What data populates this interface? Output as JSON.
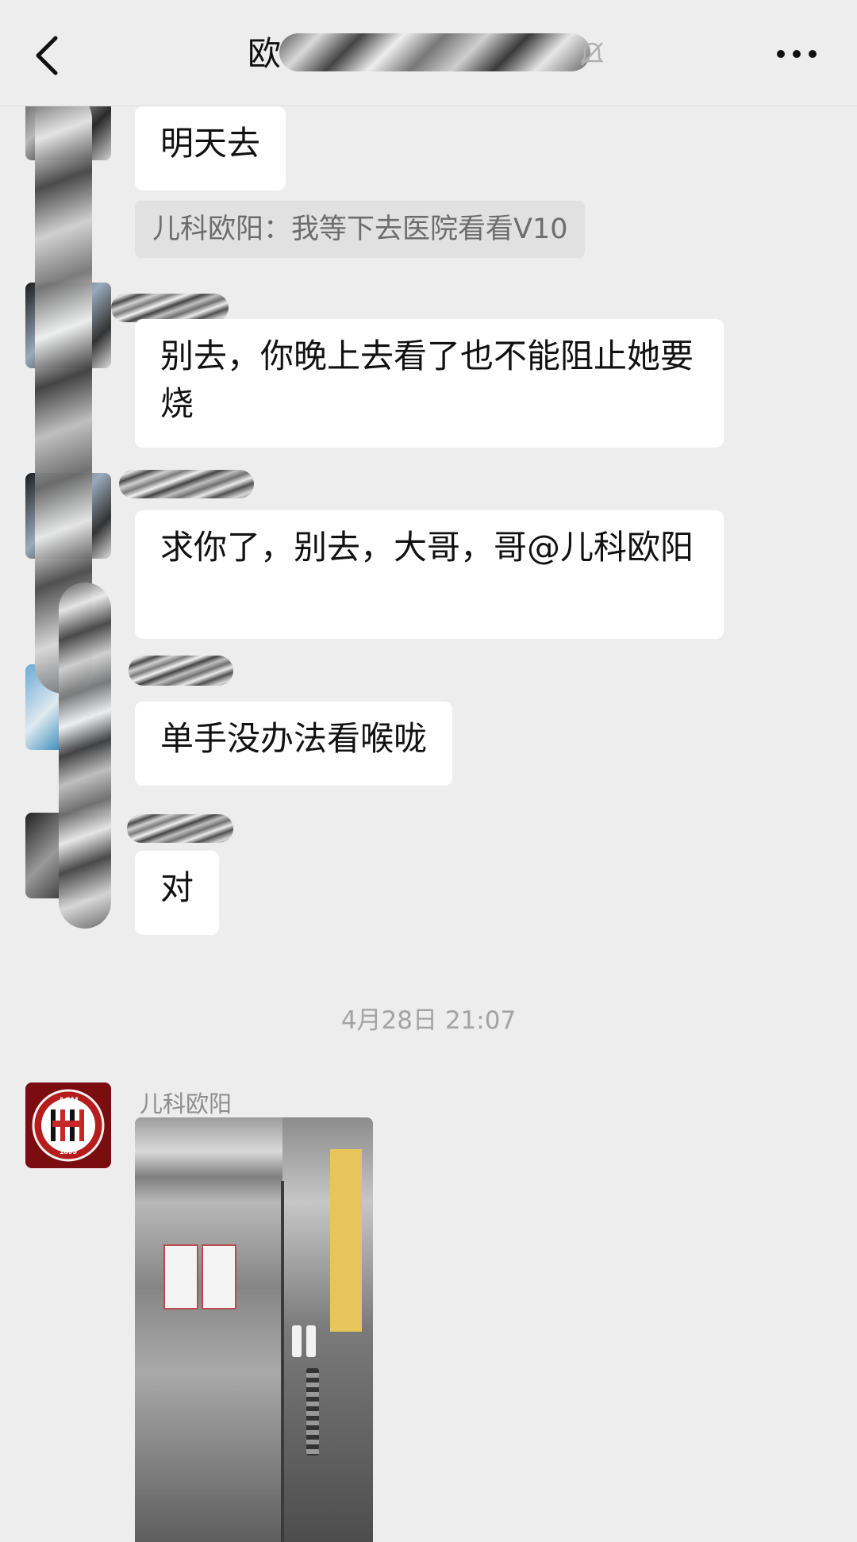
{
  "header": {
    "title": "欧",
    "back_icon": "chevron-left-icon",
    "mute_icon": "bell-muted-icon",
    "more_icon": "more-dots-icon"
  },
  "messages": [
    {
      "text": "明天去"
    },
    {
      "quote": "儿科欧阳：我等下去医院看看V10"
    },
    {
      "text": "别去，你晚上去看了也不能阻止她要烧"
    },
    {
      "text": "求你了，别去，大哥，哥@儿科欧阳"
    },
    {
      "text": "单手没办法看喉咙"
    },
    {
      "text": "对"
    }
  ],
  "timestamp": "4月28日 21:07",
  "image_message": {
    "sender": "儿科欧阳",
    "avatar_text_top": "ACM",
    "avatar_text_bottom": "1899"
  },
  "colors": {
    "background": "#ededed",
    "bubble": "#ffffff",
    "acm_red": "#7b0c10"
  }
}
